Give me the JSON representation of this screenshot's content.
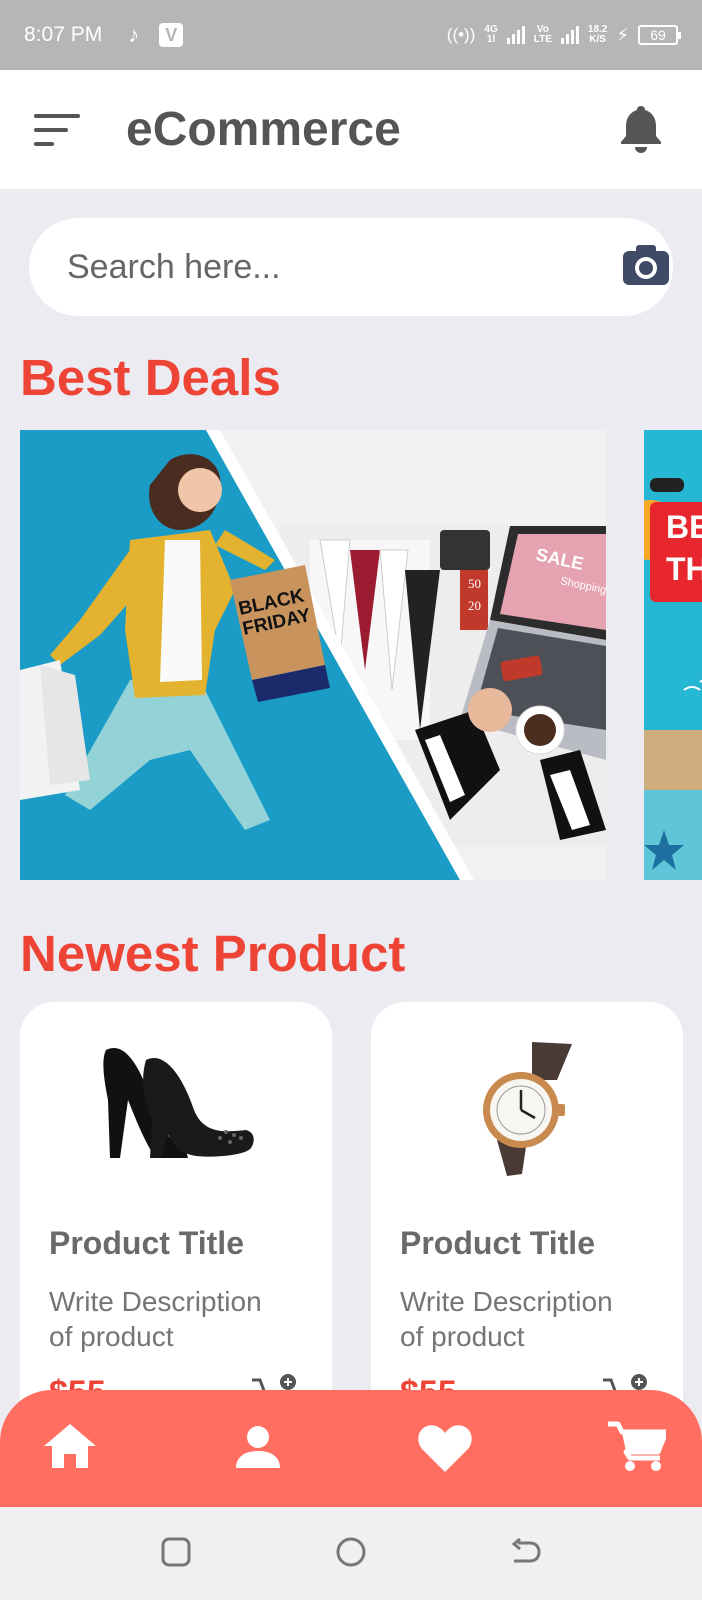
{
  "status_bar": {
    "time": "8:07 PM",
    "network_4g_top": "4G",
    "network_4g_bottom": "1l",
    "volte_top": "Vo",
    "volte_bottom": "LTE",
    "speed_top": "18.2",
    "speed_bottom": "K/S",
    "battery": "69"
  },
  "app_bar": {
    "title": "eCommerce",
    "menu_icon": "menu-icon",
    "notification_icon": "bell-icon"
  },
  "search": {
    "placeholder": "Search here...",
    "icon": "camera-icon"
  },
  "best_deals": {
    "title": "Best Deals",
    "banners": [
      {
        "bag_line1": "BLACK",
        "bag_line2": "FRIDAY",
        "tag_sale": "SALE",
        "tag_shopping": "Shopping",
        "price_1": "50",
        "price_2": "20"
      },
      {
        "text_1": "BE",
        "text_2": "TH"
      }
    ]
  },
  "newest_product": {
    "title": "Newest Product",
    "products": [
      {
        "title": "Product Title",
        "description": "Write Description of product",
        "price": "$55",
        "image": "high-heel-shoes"
      },
      {
        "title": "Product Title",
        "description": "Write Description of product",
        "price": "$55",
        "image": "wrist-watch"
      }
    ]
  },
  "bottom_nav": {
    "items": [
      "home-icon",
      "profile-icon",
      "heart-icon",
      "cart-icon"
    ]
  },
  "system_nav": {
    "items": [
      "recent-apps-button",
      "home-button",
      "back-button"
    ]
  },
  "colors": {
    "accent_red": "#EE4436",
    "nav_bg": "#FF6E61",
    "page_bg": "#ECEBF1",
    "status_bar": "#B6B6B6"
  }
}
